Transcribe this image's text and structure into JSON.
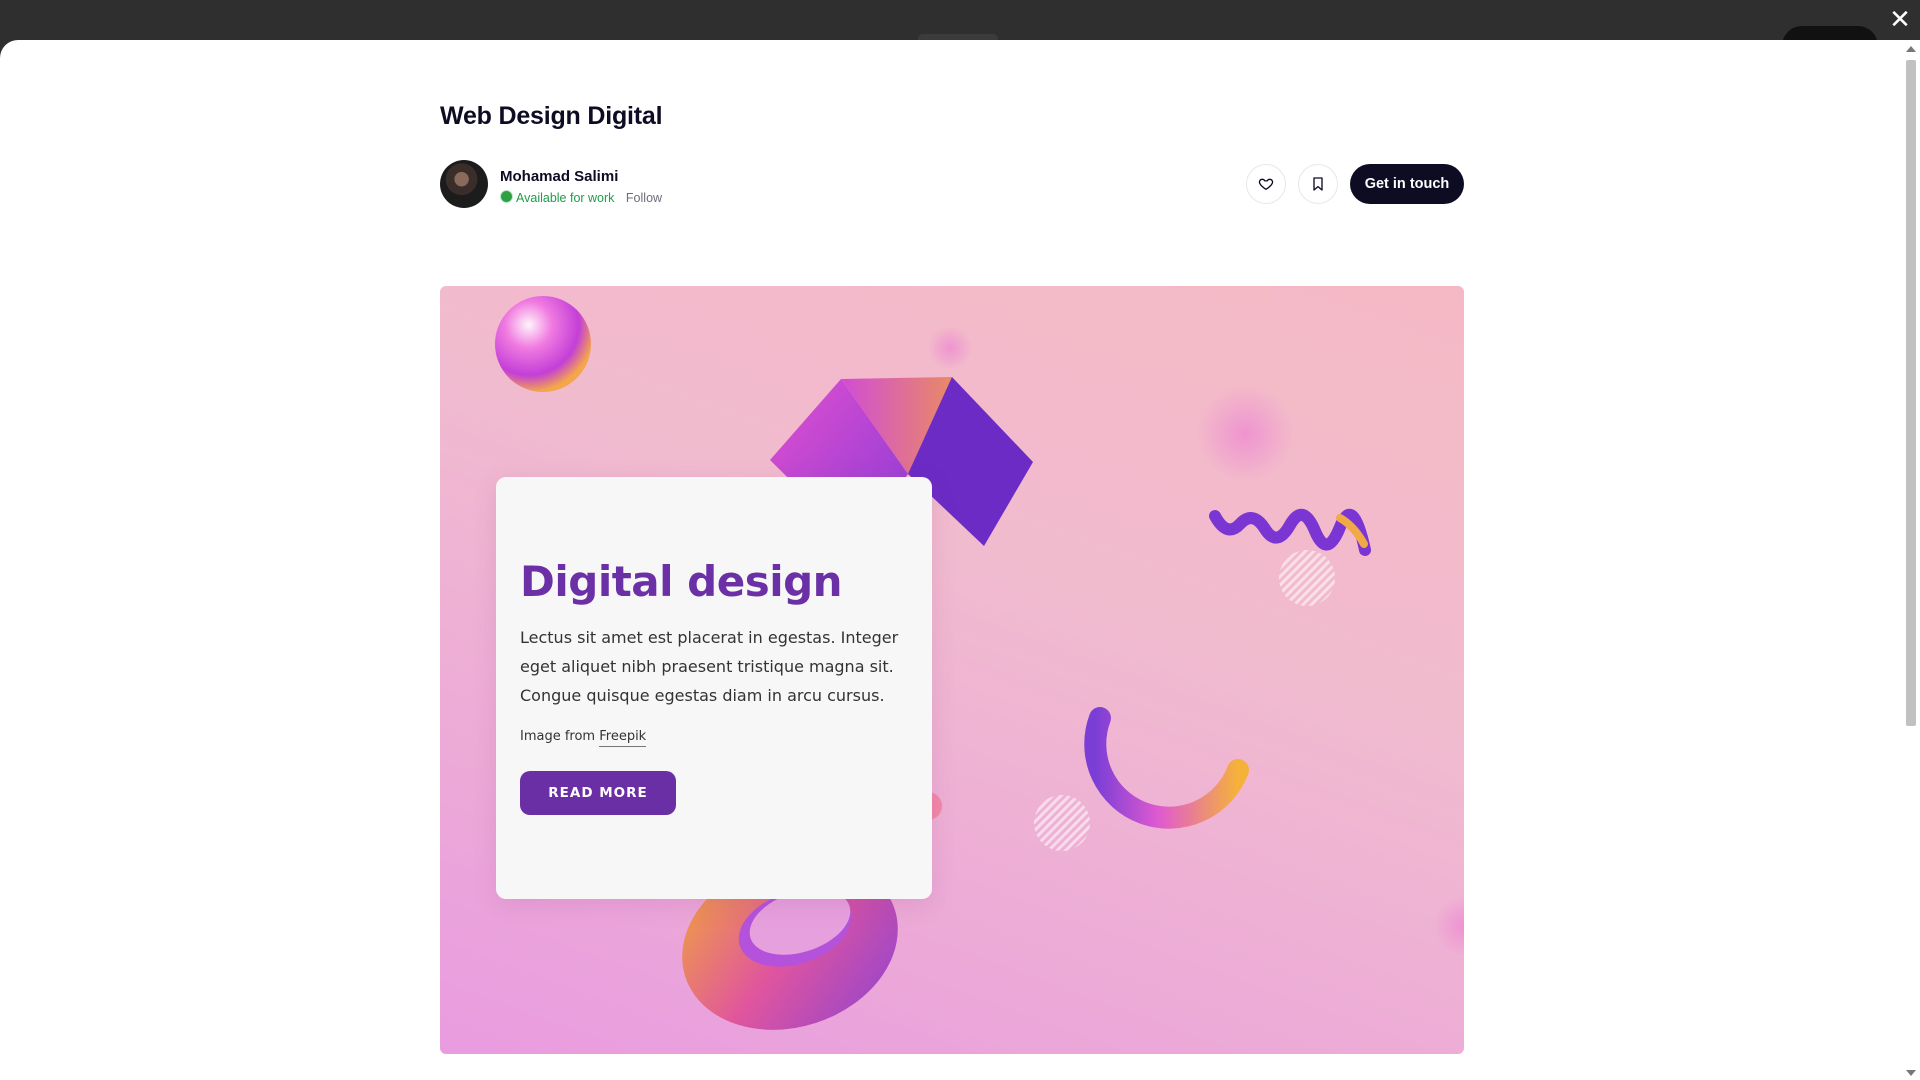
{
  "shot": {
    "title": "Web Design Digital"
  },
  "author": {
    "name": "Mohamad Salimi",
    "status": "Available for work",
    "follow_label": "Follow"
  },
  "actions": {
    "like_icon": "heart-icon",
    "save_icon": "bookmark-icon",
    "contact_label": "Get in touch"
  },
  "overlay": {
    "close_glyph": "✕"
  },
  "hero": {
    "card_title": "Digital design",
    "card_body": "Lectus sit amet est placerat in egestas. Integer eget aliquet nibh praesent tristique magna sit. Congue quisque egestas diam in arcu cursus.",
    "credit_prefix": "Image from ",
    "credit_link": "Freepik",
    "cta_label": "READ MORE"
  },
  "colors": {
    "primary": "#0d0c22",
    "available": "#1f9d49",
    "card_accent": "#6a2ea5"
  }
}
